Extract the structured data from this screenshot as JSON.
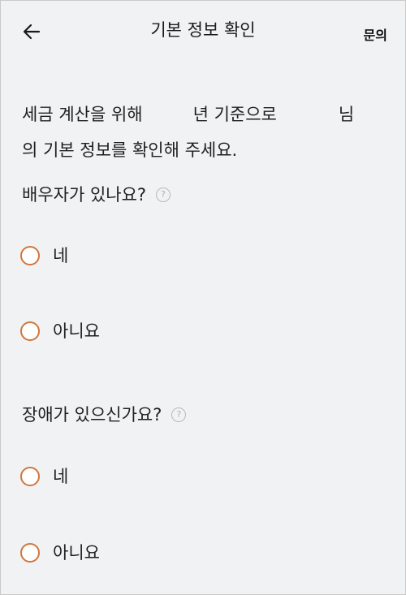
{
  "header": {
    "back_icon": "arrow-left-icon",
    "title": "기본 정보 확인",
    "inquiry_label": "문의"
  },
  "intro": {
    "part1": "세금 계산을 위해",
    "part2": "년 기준으로",
    "part3": "님",
    "line2": "의 기본 정보를 확인해 주세요."
  },
  "questions": [
    {
      "text": "배우자가 있나요?",
      "help_icon": "question-circle-icon",
      "help_glyph": "?",
      "options": [
        "네",
        "아니요"
      ]
    },
    {
      "text": "장애가 있으신가요?",
      "help_icon": "question-circle-icon",
      "help_glyph": "?",
      "options": [
        "네",
        "아니요"
      ]
    }
  ],
  "colors": {
    "background": "#f1f2f4",
    "radio_border": "#d0763e",
    "help_icon": "#b9b9b9"
  }
}
